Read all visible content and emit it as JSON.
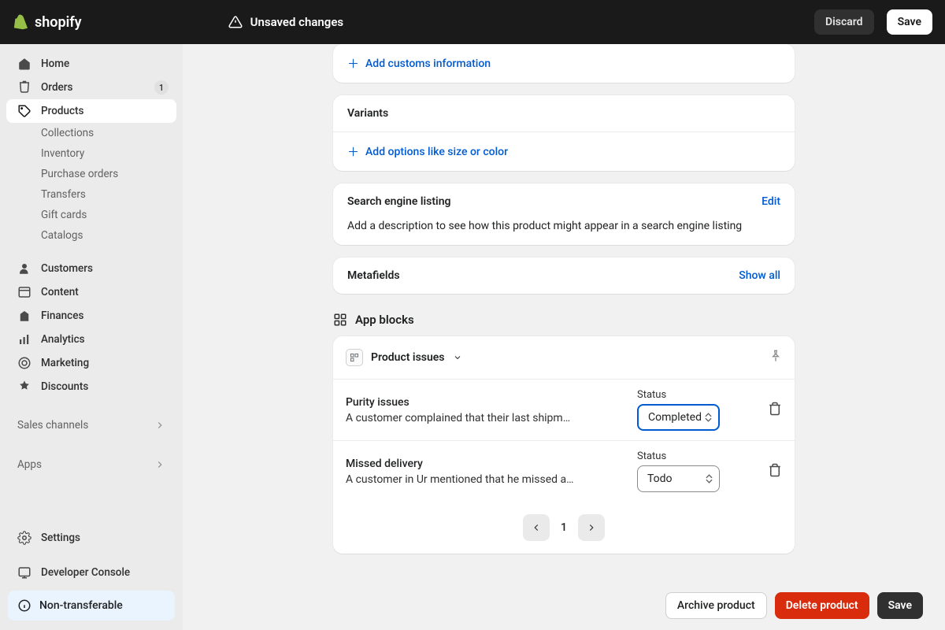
{
  "topbar": {
    "brand": "shopify",
    "unsaved": "Unsaved changes",
    "discard": "Discard",
    "save": "Save"
  },
  "sidebar": {
    "home": "Home",
    "orders": "Orders",
    "orders_badge": "1",
    "products": "Products",
    "collections": "Collections",
    "inventory": "Inventory",
    "purchase_orders": "Purchase orders",
    "transfers": "Transfers",
    "gift_cards": "Gift cards",
    "catalogs": "Catalogs",
    "customers": "Customers",
    "content": "Content",
    "finances": "Finances",
    "analytics": "Analytics",
    "marketing": "Marketing",
    "discounts": "Discounts",
    "sales_channels": "Sales channels",
    "apps": "Apps",
    "settings": "Settings",
    "developer_console": "Developer Console",
    "banner": "Non-transferable"
  },
  "cards": {
    "customs_link": "Add customs information",
    "variants_title": "Variants",
    "variants_link": "Add options like size or color",
    "seo_title": "Search engine listing",
    "seo_edit": "Edit",
    "seo_body": "Add a description to see how this product might appear in a search engine listing",
    "metafields_title": "Metafields",
    "metafields_link": "Show all"
  },
  "appblocks": {
    "title": "App blocks",
    "block_name": "Product issues",
    "issues": [
      {
        "title": "Purity issues",
        "desc": "A customer complained that their last shipme…",
        "status_label": "Status",
        "status_value": "Completed"
      },
      {
        "title": "Missed delivery",
        "desc": "A customer in Ur mentioned that he missed a…",
        "status_label": "Status",
        "status_value": "Todo"
      }
    ],
    "page": "1"
  },
  "footer": {
    "archive": "Archive product",
    "delete": "Delete product",
    "save": "Save"
  }
}
